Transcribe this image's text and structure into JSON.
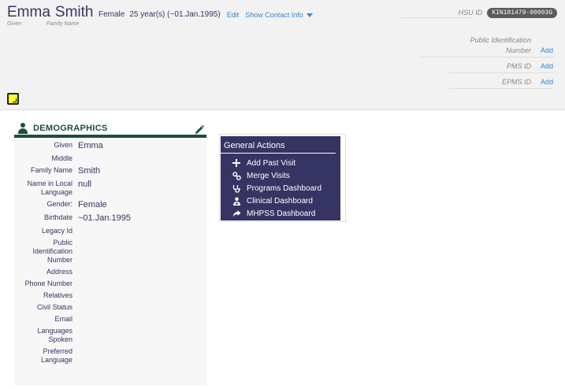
{
  "patient": {
    "given": "Emma",
    "family": "Smith",
    "given_label": "Given",
    "family_label": "Family Name",
    "gender": "Female",
    "age_birth": "25 year(s) (~01.Jan.1995)",
    "edit_label": "Edit",
    "contact_label": "Show Contact Info"
  },
  "identifiers": {
    "hsu_label": "HSU ID",
    "hsu_value": "KIN101479-00003G",
    "public_id_label_1": "Public Identification",
    "public_id_label_2": "Number",
    "pms_label": "PMS ID",
    "epms_label": "EPMS ID",
    "add_label": "Add"
  },
  "demographics": {
    "title": "DEMOGRAPHICS",
    "fields": [
      {
        "label": "Given",
        "value": "Emma"
      },
      {
        "label": "Middle",
        "value": ""
      },
      {
        "label": "Family Name",
        "value": "Smith"
      },
      {
        "label": "Name in Local Language",
        "value": "null"
      },
      {
        "label": "Gender:",
        "value": "Female"
      },
      {
        "label": "Birthdate",
        "value": "~01.Jan.1995"
      },
      {
        "label": "Legacy Id",
        "value": ""
      },
      {
        "label": "Public Identification Number",
        "value": ""
      },
      {
        "label": "Address",
        "value": ""
      },
      {
        "label": "Phone Number",
        "value": ""
      },
      {
        "label": "Relatives",
        "value": ""
      },
      {
        "label": "Civil Status",
        "value": ""
      },
      {
        "label": "Email",
        "value": ""
      },
      {
        "label": "Languages Spoken",
        "value": ""
      },
      {
        "label": "Preferred Language",
        "value": ""
      }
    ]
  },
  "actions": {
    "title": "General Actions",
    "items": [
      {
        "label": "Add Past Visit",
        "icon": "plus-icon"
      },
      {
        "label": "Merge Visits",
        "icon": "link-icon"
      },
      {
        "label": "Programs Dashboard",
        "icon": "stethoscope-icon"
      },
      {
        "label": "Clinical Dashboard",
        "icon": "user-md-icon"
      },
      {
        "label": "MHPSS Dashboard",
        "icon": "share-arrow-icon"
      }
    ]
  },
  "colors": {
    "primary": "#363463",
    "accent_green": "#1e4d40",
    "link": "#3a86c8",
    "sticky_note": "#ffff2e"
  }
}
